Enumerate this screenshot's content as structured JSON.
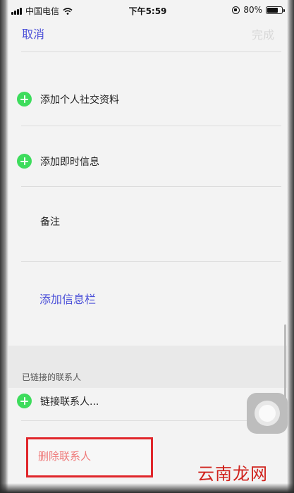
{
  "status_bar": {
    "carrier": "中国电信",
    "time": "下午5:59",
    "battery_percent": "80%",
    "battery_level": 0.8
  },
  "nav": {
    "cancel_label": "取消",
    "done_label": "完成"
  },
  "rows": {
    "add_social_profile": "添加个人社交资料",
    "add_instant_message": "添加即时信息",
    "notes": "备注",
    "add_field": "添加信息栏"
  },
  "linked_contacts": {
    "header": "已链接的联系人",
    "link_label": "链接联系人..."
  },
  "delete_contact_label": "删除联系人",
  "watermark": "云南龙网",
  "colors": {
    "accent": "#4a4fd8",
    "add_icon": "#3ddc5c",
    "delete_text": "#ef7a7a",
    "highlight_box": "#e0262b"
  }
}
